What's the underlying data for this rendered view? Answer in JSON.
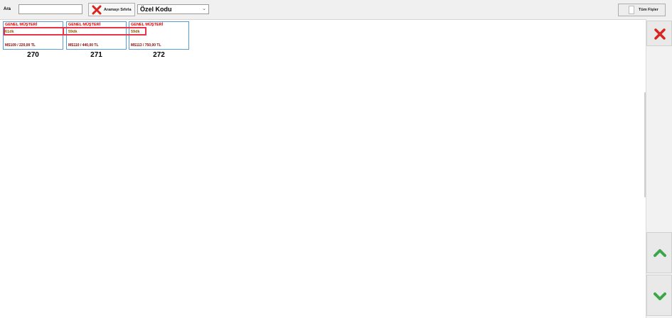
{
  "toolbar": {
    "search_label": "Ara",
    "search_value": "",
    "reset_label": "Aramayı Sıfırla",
    "field_value": "Özel Kodu",
    "all_label": "Tüm Fişler"
  },
  "cards": [
    {
      "customer": "GENEL MÜŞTERİ",
      "time": "61dk",
      "info": "MS109 / 220,00 TL",
      "number": "270"
    },
    {
      "customer": "GENEL MÜŞTERİ",
      "time": "59dk",
      "info": "MS110 / 440,00 TL",
      "number": "271"
    },
    {
      "customer": "GENEL MÜŞTERİ",
      "time": "59dk",
      "info": "MS113 / 750,00 TL",
      "number": "272"
    }
  ],
  "colors": {
    "accent_red": "#e00000",
    "card_border": "#5b9bd5",
    "highlight": "#e8334a",
    "arrow_green": "#3aa64a"
  },
  "icons": {
    "reset": "red-x-icon",
    "close": "red-x-icon",
    "scroll_up": "green-chevron-up-icon",
    "scroll_down": "green-chevron-down-icon"
  }
}
